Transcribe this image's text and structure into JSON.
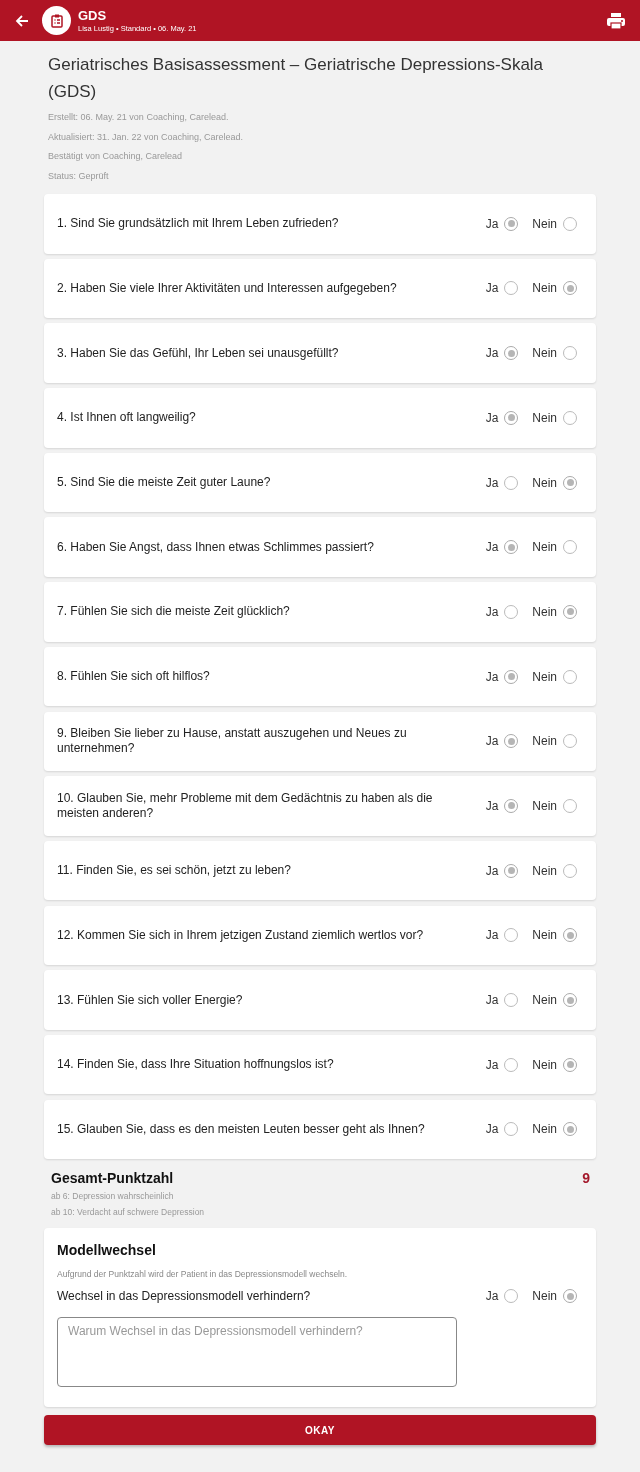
{
  "app_bar": {
    "title": "GDS",
    "subtitle": "Lisa Lustig • Standard • 06. May. 21"
  },
  "header": {
    "title": "Geriatrisches Basisassessment – Geriatrische Depressions-Skala (GDS)",
    "meta": [
      "Erstellt: 06. May. 21 von Coaching, Carelead.",
      "Aktualisiert: 31. Jan. 22 von Coaching, Carelead.",
      "Bestätigt von Coaching, Carelead",
      "Status: Geprüft"
    ]
  },
  "questions": [
    {
      "text": "1. Sind Sie grundsätzlich mit Ihrem Leben zufrieden?",
      "options": [
        {
          "label": "Ja",
          "selected": true
        },
        {
          "label": "Nein",
          "selected": false
        }
      ]
    },
    {
      "text": "2. Haben Sie viele Ihrer Aktivitäten und Interessen aufgegeben?",
      "options": [
        {
          "label": "Ja",
          "selected": false
        },
        {
          "label": "Nein",
          "selected": true
        }
      ]
    },
    {
      "text": "3. Haben Sie das Gefühl, Ihr Leben sei unausgefüllt?",
      "options": [
        {
          "label": "Ja",
          "selected": true
        },
        {
          "label": "Nein",
          "selected": false
        }
      ]
    },
    {
      "text": "4. Ist Ihnen oft langweilig?",
      "options": [
        {
          "label": "Ja",
          "selected": true
        },
        {
          "label": "Nein",
          "selected": false
        }
      ]
    },
    {
      "text": "5. Sind Sie die meiste Zeit guter Laune?",
      "options": [
        {
          "label": "Ja",
          "selected": false
        },
        {
          "label": "Nein",
          "selected": true
        }
      ]
    },
    {
      "text": "6. Haben Sie Angst, dass Ihnen etwas Schlimmes passiert?",
      "options": [
        {
          "label": "Ja",
          "selected": true
        },
        {
          "label": "Nein",
          "selected": false
        }
      ]
    },
    {
      "text": "7. Fühlen Sie sich die meiste Zeit glücklich?",
      "options": [
        {
          "label": "Ja",
          "selected": false
        },
        {
          "label": "Nein",
          "selected": true
        }
      ]
    },
    {
      "text": "8. Fühlen Sie sich oft hilflos?",
      "options": [
        {
          "label": "Ja",
          "selected": true
        },
        {
          "label": "Nein",
          "selected": false
        }
      ]
    },
    {
      "text": "9. Bleiben Sie lieber zu Hause, anstatt auszugehen und Neues zu unternehmen?",
      "options": [
        {
          "label": "Ja",
          "selected": true
        },
        {
          "label": "Nein",
          "selected": false
        }
      ]
    },
    {
      "text": "10. Glauben Sie, mehr Probleme mit dem Gedächtnis zu haben als die meisten anderen?",
      "options": [
        {
          "label": "Ja",
          "selected": true
        },
        {
          "label": "Nein",
          "selected": false
        }
      ]
    },
    {
      "text": "11. Finden Sie, es sei schön, jetzt zu leben?",
      "options": [
        {
          "label": "Ja",
          "selected": true
        },
        {
          "label": "Nein",
          "selected": false
        }
      ]
    },
    {
      "text": "12. Kommen Sie sich in Ihrem jetzigen Zustand ziemlich wertlos vor?",
      "options": [
        {
          "label": "Ja",
          "selected": false
        },
        {
          "label": "Nein",
          "selected": true
        }
      ]
    },
    {
      "text": "13. Fühlen Sie sich voller Energie?",
      "options": [
        {
          "label": "Ja",
          "selected": false
        },
        {
          "label": "Nein",
          "selected": true
        }
      ]
    },
    {
      "text": "14. Finden Sie, dass Ihre Situation hoffnungslos ist?",
      "options": [
        {
          "label": "Ja",
          "selected": false
        },
        {
          "label": "Nein",
          "selected": true
        }
      ]
    },
    {
      "text": "15. Glauben Sie, dass es den meisten Leuten besser geht als Ihnen?",
      "options": [
        {
          "label": "Ja",
          "selected": false
        },
        {
          "label": "Nein",
          "selected": true
        }
      ]
    }
  ],
  "score": {
    "title": "Gesamt-Punktzahl",
    "value": "9",
    "notes": [
      "ab 6: Depression wahrscheinlich",
      "ab 10: Verdacht auf schwere Depression"
    ]
  },
  "model_change": {
    "title": "Modellwechsel",
    "description": "Aufgrund der Punktzahl wird der Patient in das Depressionsmodell wechseln.",
    "question": "Wechsel in das Depressionsmodell verhindern?",
    "options": [
      {
        "label": "Ja",
        "selected": false
      },
      {
        "label": "Nein",
        "selected": true
      }
    ],
    "reason_placeholder": "Warum Wechsel in das Depressionsmodell verhindern?"
  },
  "button": "OKAY"
}
